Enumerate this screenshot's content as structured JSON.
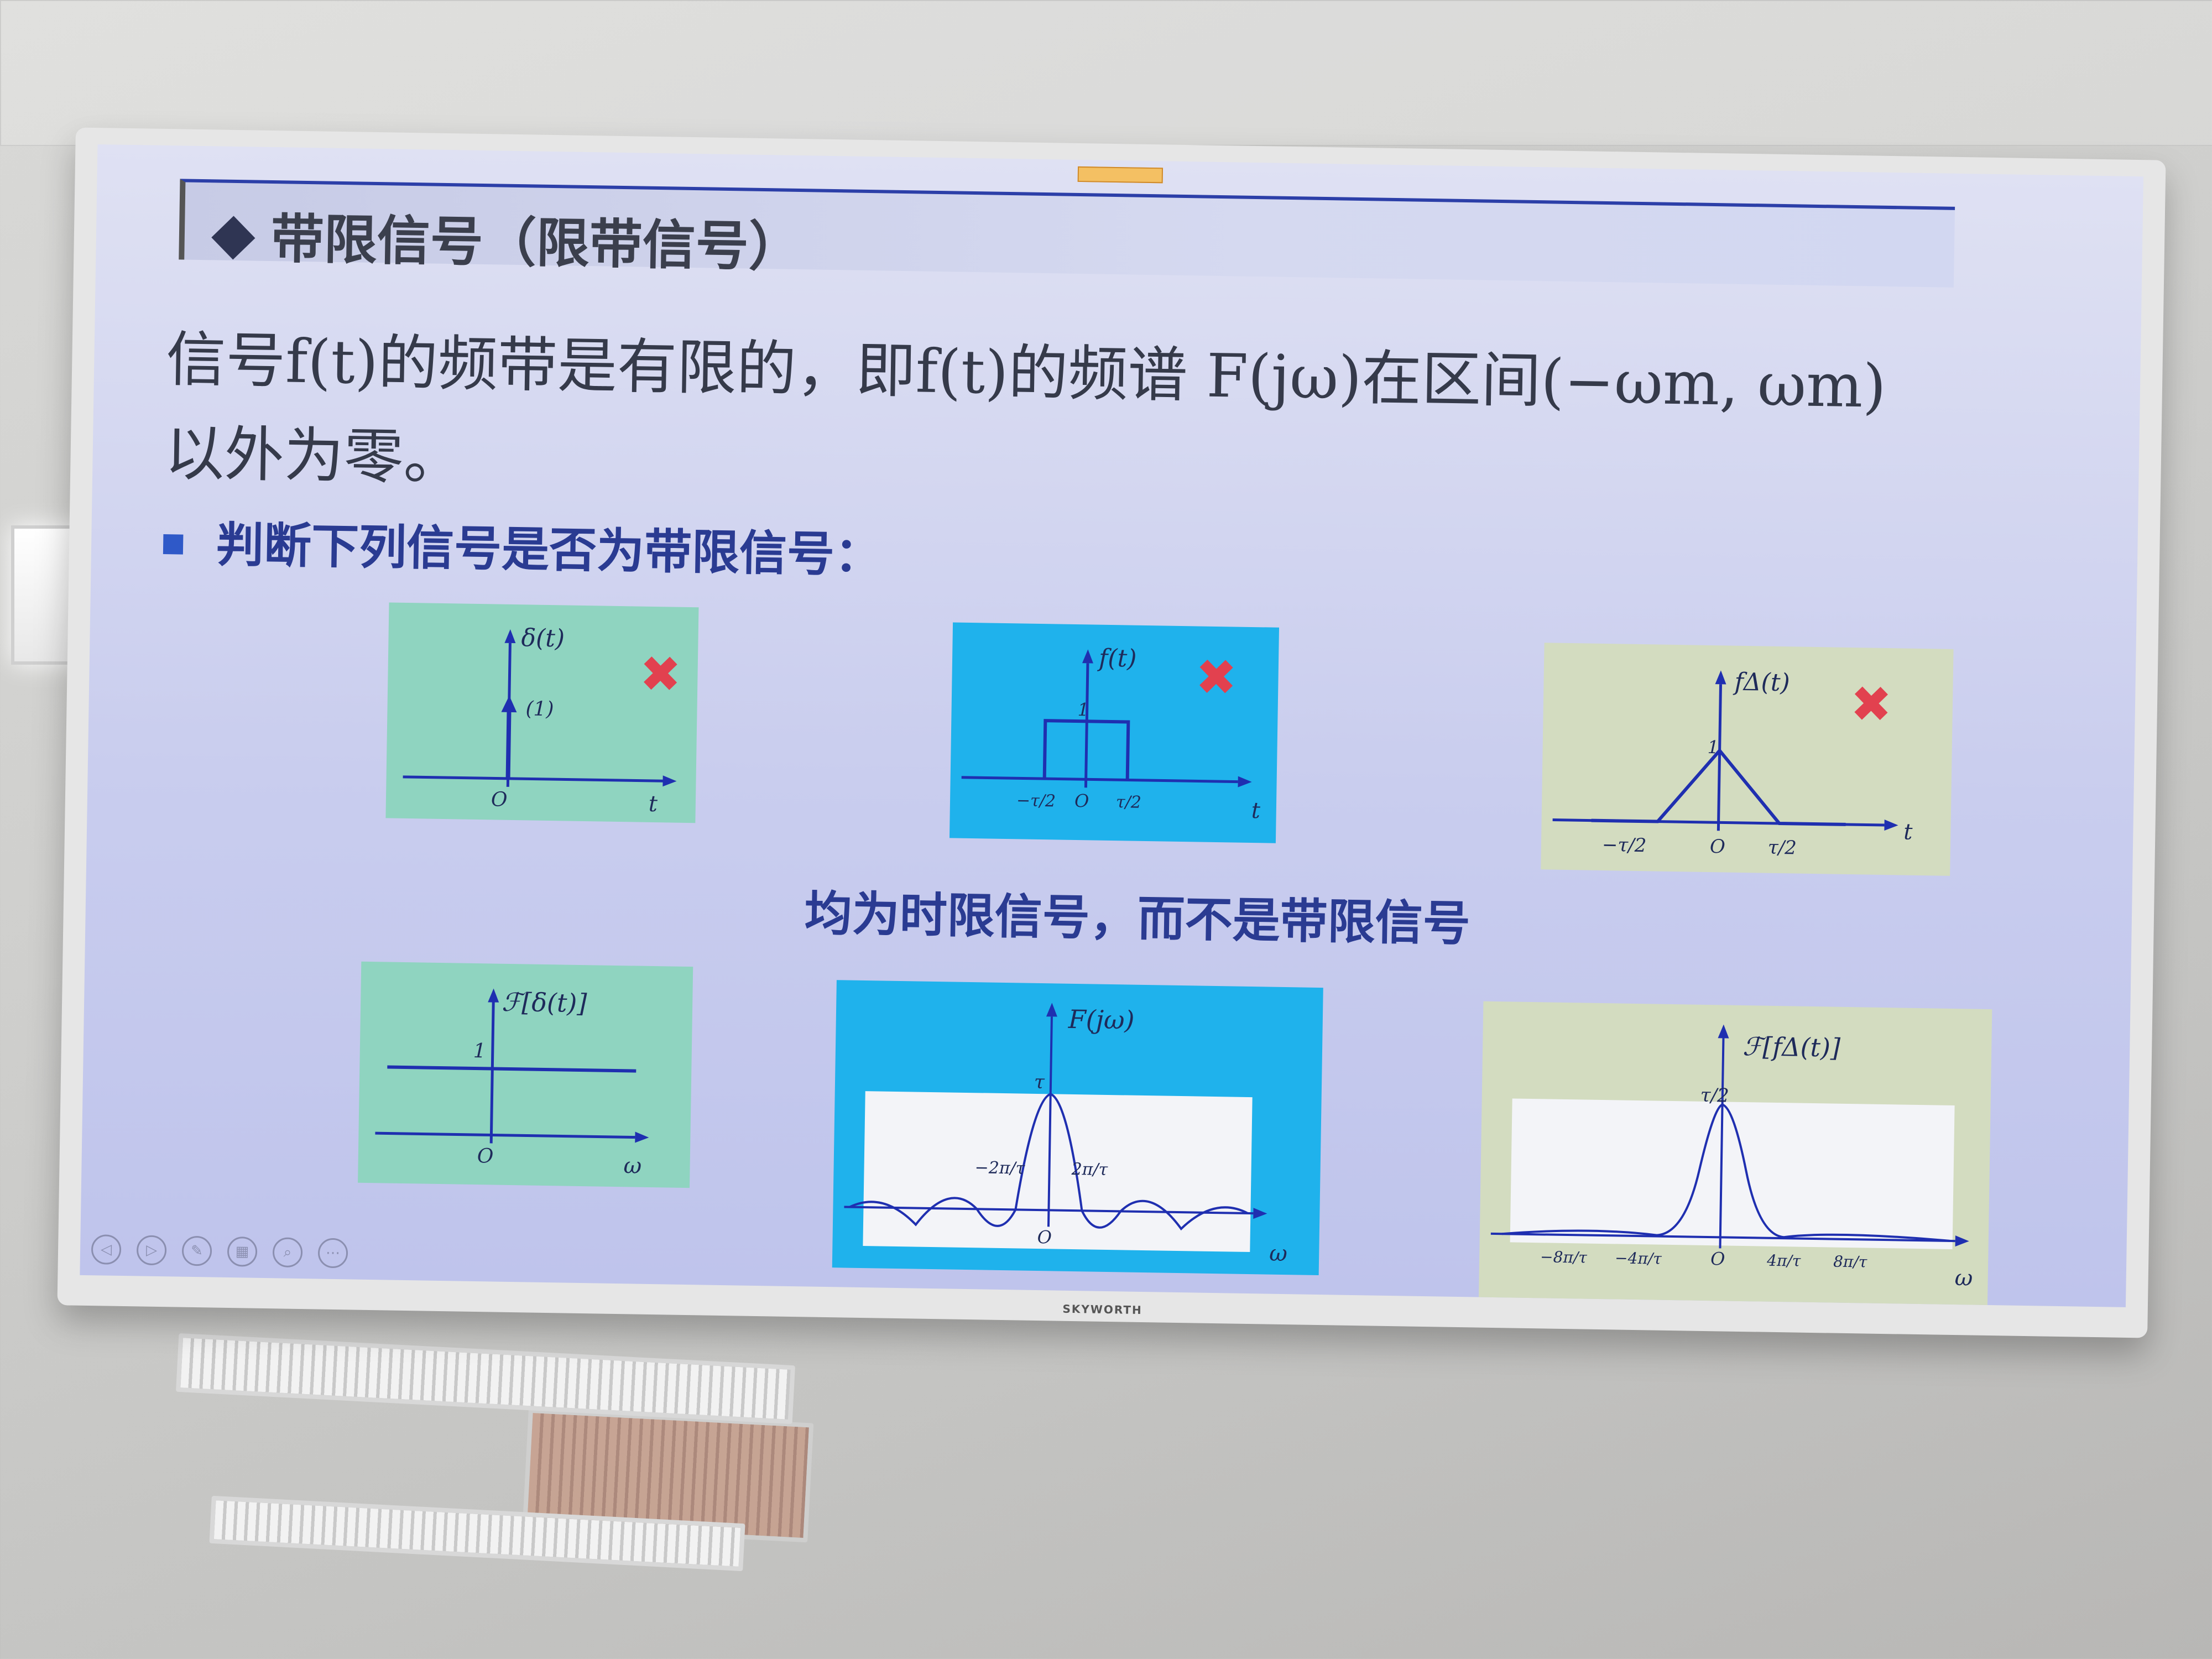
{
  "slide": {
    "header_title": "带限信号（限带信号）",
    "line1": "信号f(t)的频带是有限的，即f(t)的频谱 F(jω)在区间(−ωm, ωm)",
    "line2": "以外为零。",
    "bullet": "判断下列信号是否为带限信号：",
    "note": "均为时限信号，而不是带限信号",
    "tv_brand": "SKYWORTH",
    "mark": "✖"
  },
  "panels_top": [
    {
      "label": "δ(t)",
      "amp": "(1)",
      "origin": "O",
      "xaxis": "t"
    },
    {
      "label": "f(t)",
      "level": "1",
      "left_tick": "−τ/2",
      "origin": "O",
      "right_tick": "τ/2",
      "xaxis": "t"
    },
    {
      "label": "fΔ(t)",
      "level": "1",
      "left_tick": "−τ/2",
      "origin": "O",
      "right_tick": "τ/2",
      "xaxis": "t"
    }
  ],
  "panels_bottom": [
    {
      "label": "ℱ[δ(t)]",
      "level": "1",
      "origin": "O",
      "xaxis": "ω"
    },
    {
      "label": "F(jω)",
      "peak": "τ",
      "left_tick": "−2π/τ",
      "right_tick": "2π/τ",
      "origin": "O",
      "xaxis": "ω"
    },
    {
      "label": "ℱ[fΔ(t)]",
      "peak": "τ/2",
      "ticks": [
        "−8π/τ",
        "−4π/τ",
        "O",
        "4π/τ",
        "8π/τ"
      ],
      "xaxis": "ω"
    }
  ],
  "colors": {
    "green_panel": "#8fd4c0",
    "blue_panel": "#1fb2ec",
    "beige_panel": "#d3dcc0",
    "axis": "#1f2fb0",
    "cross": "#e2414f"
  }
}
